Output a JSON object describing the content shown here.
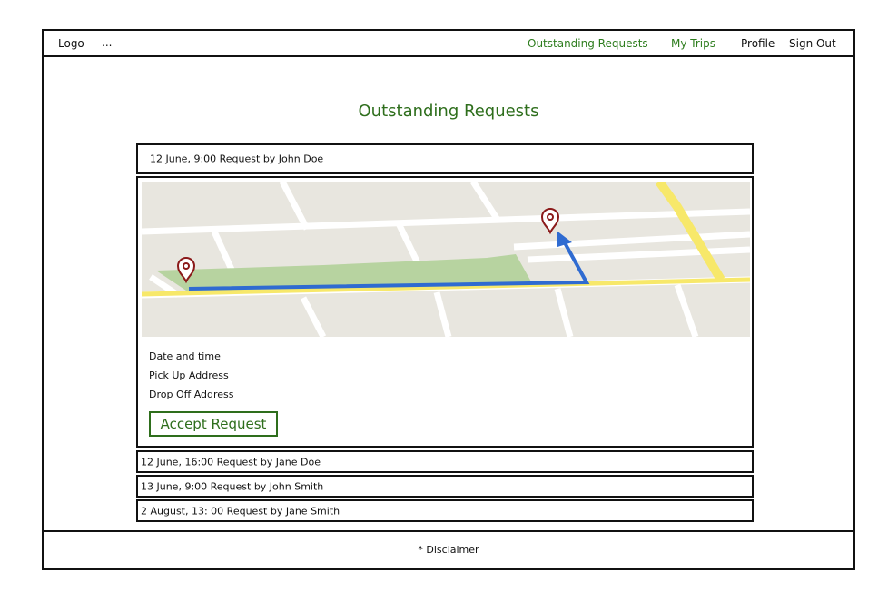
{
  "navbar": {
    "logo": "Logo",
    "ellipsis": "...",
    "items": [
      {
        "label": "Outstanding Requests"
      },
      {
        "label": "My Trips"
      },
      {
        "label": "Profile"
      },
      {
        "label": "Sign Out"
      }
    ]
  },
  "page": {
    "title": "Outstanding Requests"
  },
  "requests": [
    {
      "label": "12 June, 9:00 Request by John Doe"
    },
    {
      "label": "12 June, 16:00 Request by Jane Doe"
    },
    {
      "label": "13 June, 9:00 Request by John Smith"
    },
    {
      "label": "2 August, 13: 00 Request by Jane Smith"
    }
  ],
  "detail": {
    "fields": [
      "Date and time",
      "Pick Up Address",
      "Drop Off Address"
    ],
    "accept_label": "Accept Request"
  },
  "footer": {
    "text": "* Disclaimer"
  },
  "colors": {
    "accent_green": "#2e6e1c",
    "map_background": "#e8e6df",
    "route_blue": "#2f6bd1",
    "pin_red": "#8b1a1a",
    "highway_yellow": "#f7e86a",
    "park_green": "#b7d3a0"
  },
  "icons": [
    "map-pin-icon"
  ]
}
